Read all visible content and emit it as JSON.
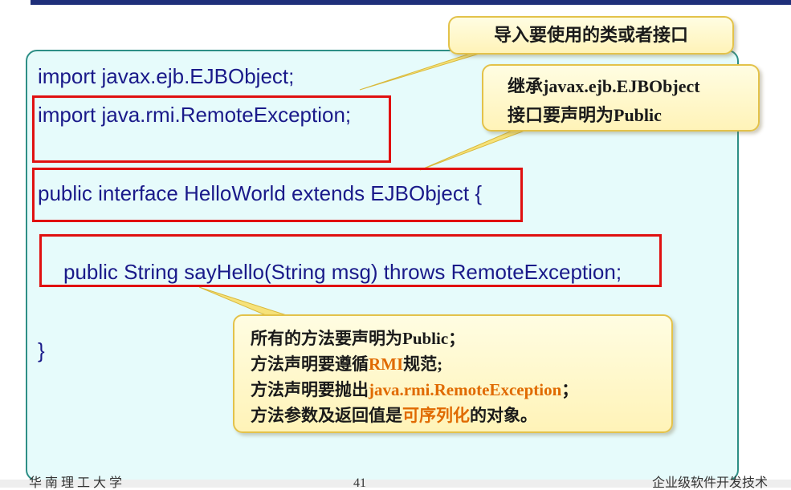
{
  "code": {
    "line1": "import javax.ejb.EJBObject;",
    "line2": "import java.rmi.RemoteException;",
    "line3": "public interface HelloWorld extends EJBObject {",
    "line4": "public String sayHello(String msg) throws RemoteException;",
    "line5": "}"
  },
  "callouts": {
    "import_note": "导入要使用的类或者接口",
    "extend_line1_prefix": "继承",
    "extend_line1_class": "javax.ejb.EJBObject",
    "extend_line2": "接口要声明为Public",
    "method_l1": "所有的方法要声明为Public；",
    "method_l2_a": "方法声明要遵循",
    "method_l2_b": "RMI",
    "method_l2_c": "规范;",
    "method_l3_a": "方法声明要抛出",
    "method_l3_b": "java.rmi.RemoteException",
    "method_l3_c": "；",
    "method_l4_a": "方法参数及返回值是",
    "method_l4_b": "可序列化",
    "method_l4_c": "的对象。"
  },
  "footer": {
    "left": "华 南 理 工 大 学",
    "center": "41",
    "right": "企业级软件开发技术"
  },
  "colors": {
    "highlight": "#e06a00",
    "frame_red": "#e01010",
    "code_blue": "#1a1a8a"
  }
}
